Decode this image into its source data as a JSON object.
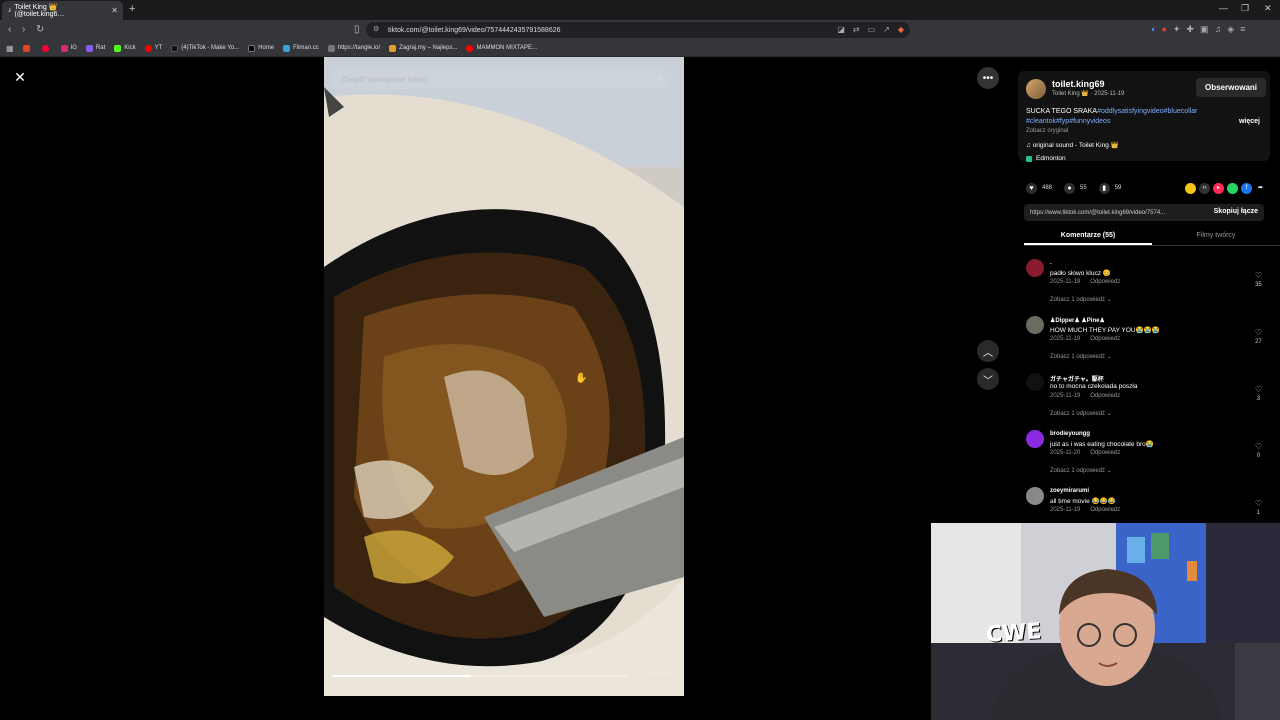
{
  "browser": {
    "tab_title": "Toilet King 👑 (@toilet.king6…",
    "url": "tiktok.com/@toilet.king69/video/7574442435791588626",
    "bookmarks": [
      "",
      "",
      "IG",
      "Rat",
      "Kick",
      "YT",
      "(4)TikTok - Make Yo...",
      "Home",
      "Filman.cc",
      "https://tangle.io/",
      "Zagraj.my – Najleps...",
      "MAMMON MIXTAPE..."
    ]
  },
  "video": {
    "search_placeholder": "Znajdź powiązane treści",
    "progress": 0.47,
    "timecode": "00:21/00:48"
  },
  "author": {
    "username": "toilet.king69",
    "display": "Toilet King 👑 · 2025-11-19",
    "follow_label": "Obserwowani",
    "desc_text": "SUCKA TEGO SRAKA",
    "desc_tags": "#oddlysatisfyingvideo#bluecollar #cleantok#fyp#funnyvideos",
    "more_label": "więcej",
    "see_original": "Zobacz oryginał",
    "sound": "original sound - Toilet King 👑",
    "location": "Edmonton"
  },
  "stats": {
    "likes": "488",
    "comments": "55",
    "saves": "59"
  },
  "link": {
    "text": "https://www.tiktok.com/@toilet.king69/video/7574...",
    "copy_label": "Skopiuj łącze"
  },
  "tabs": {
    "comments": "Komentarze (55)",
    "creator_videos": "Filmy twórcy"
  },
  "comments": [
    {
      "name": ".",
      "text": "padło słowo klucz 😊",
      "date": "2025-11-19",
      "reply": "Odpowiedz",
      "replies": "Zobacz 1 odpowiedź ⌄",
      "likes": "35",
      "color": "#8a1a2e"
    },
    {
      "name": "♟Dipper♟ ♟Pine♟",
      "text": "HOW MUCH THEY PAY YOU😭😭😭",
      "date": "2025-11-19",
      "reply": "Odpowiedz",
      "replies": "Zobacz 1 odpowiedź ⌄",
      "likes": "27",
      "color": "#6b6b60"
    },
    {
      "name": "ガチャガチャ。駆杯",
      "text": "no to mocna czekolada poszła",
      "date": "2025-11-19",
      "reply": "Odpowiedz",
      "replies": "Zobacz 1 odpowiedź ⌄",
      "likes": "3",
      "color": "#111111"
    },
    {
      "name": "brodieyoungg",
      "text": "just as i was eating chocolate bro😭",
      "date": "2025-11-20",
      "reply": "Odpowiedz",
      "replies": "Zobacz 1 odpowiedź ⌄",
      "likes": "0",
      "color": "#8a2be2"
    },
    {
      "name": "zoeymirarumi",
      "text": "all time movie 😂😂😂",
      "date": "2025-11-19",
      "reply": "Odpowiedz",
      "replies": "",
      "likes": "1",
      "color": "#888888"
    }
  ],
  "webcam": {
    "shirt_text": "CWE"
  }
}
